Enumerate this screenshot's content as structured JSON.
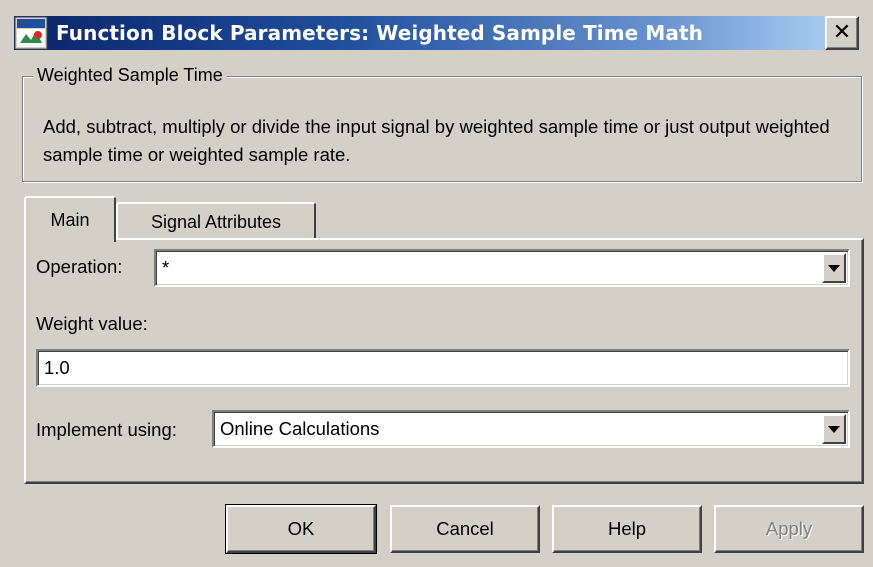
{
  "window": {
    "title": "Function Block Parameters: Weighted Sample Time Math",
    "close_glyph": "✕"
  },
  "group": {
    "legend": "Weighted Sample Time",
    "description": "Add, subtract, multiply or divide the input signal by weighted sample time or just output weighted sample time or weighted sample rate."
  },
  "tabs": [
    {
      "label": "Main",
      "selected": true
    },
    {
      "label": "Signal Attributes",
      "selected": false
    }
  ],
  "main": {
    "operation_label": "Operation:",
    "operation_value": "*",
    "weight_label": "Weight value:",
    "weight_value": "1.0",
    "implement_label": "Implement using:",
    "implement_value": "Online Calculations"
  },
  "buttons": {
    "ok": "OK",
    "cancel": "Cancel",
    "help": "Help",
    "apply": "Apply"
  },
  "colors": {
    "face": "#d4d0c8",
    "title_gradient_start": "#0a246a",
    "title_gradient_end": "#a6caf0",
    "disabled_text": "#808080"
  }
}
